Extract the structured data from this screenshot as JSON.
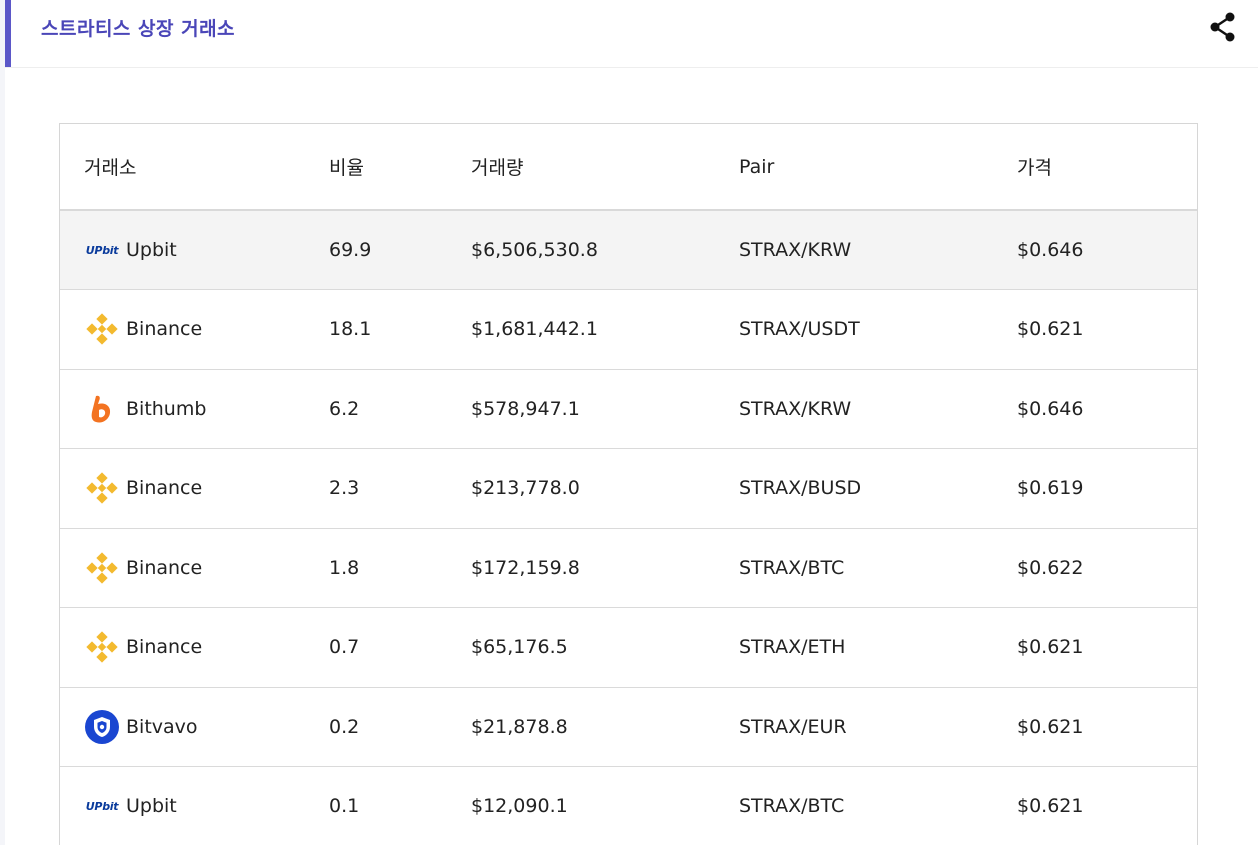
{
  "header": {
    "title": "스트라티스 상장 거래소",
    "accent_color": "#5b57c8",
    "share_icon": "share-icon"
  },
  "table": {
    "columns": [
      "거래소",
      "비율",
      "거래량",
      "Pair",
      "가격"
    ],
    "rows": [
      {
        "exchange": "Upbit",
        "logo": "upbit-logo",
        "logo_text": "UPbit",
        "ratio": "69.9",
        "volume": "$6,506,530.8",
        "pair": "STRAX/KRW",
        "price": "$0.646"
      },
      {
        "exchange": "Binance",
        "logo": "binance-logo",
        "ratio": "18.1",
        "volume": "$1,681,442.1",
        "pair": "STRAX/USDT",
        "price": "$0.621"
      },
      {
        "exchange": "Bithumb",
        "logo": "bithumb-logo",
        "ratio": "6.2",
        "volume": "$578,947.1",
        "pair": "STRAX/KRW",
        "price": "$0.646"
      },
      {
        "exchange": "Binance",
        "logo": "binance-logo",
        "ratio": "2.3",
        "volume": "$213,778.0",
        "pair": "STRAX/BUSD",
        "price": "$0.619"
      },
      {
        "exchange": "Binance",
        "logo": "binance-logo",
        "ratio": "1.8",
        "volume": "$172,159.8",
        "pair": "STRAX/BTC",
        "price": "$0.622"
      },
      {
        "exchange": "Binance",
        "logo": "binance-logo",
        "ratio": "0.7",
        "volume": "$65,176.5",
        "pair": "STRAX/ETH",
        "price": "$0.621"
      },
      {
        "exchange": "Bitvavo",
        "logo": "bitvavo-logo",
        "ratio": "0.2",
        "volume": "$21,878.8",
        "pair": "STRAX/EUR",
        "price": "$0.621"
      },
      {
        "exchange": "Upbit",
        "logo": "upbit-logo",
        "logo_text": "UPbit",
        "ratio": "0.1",
        "volume": "$12,090.1",
        "pair": "STRAX/BTC",
        "price": "$0.621"
      }
    ]
  },
  "colors": {
    "binance": "#f3ba2f",
    "bithumb": "#f37321",
    "bitvavo": "#1a46d1",
    "upbit": "#0a3b9c"
  }
}
